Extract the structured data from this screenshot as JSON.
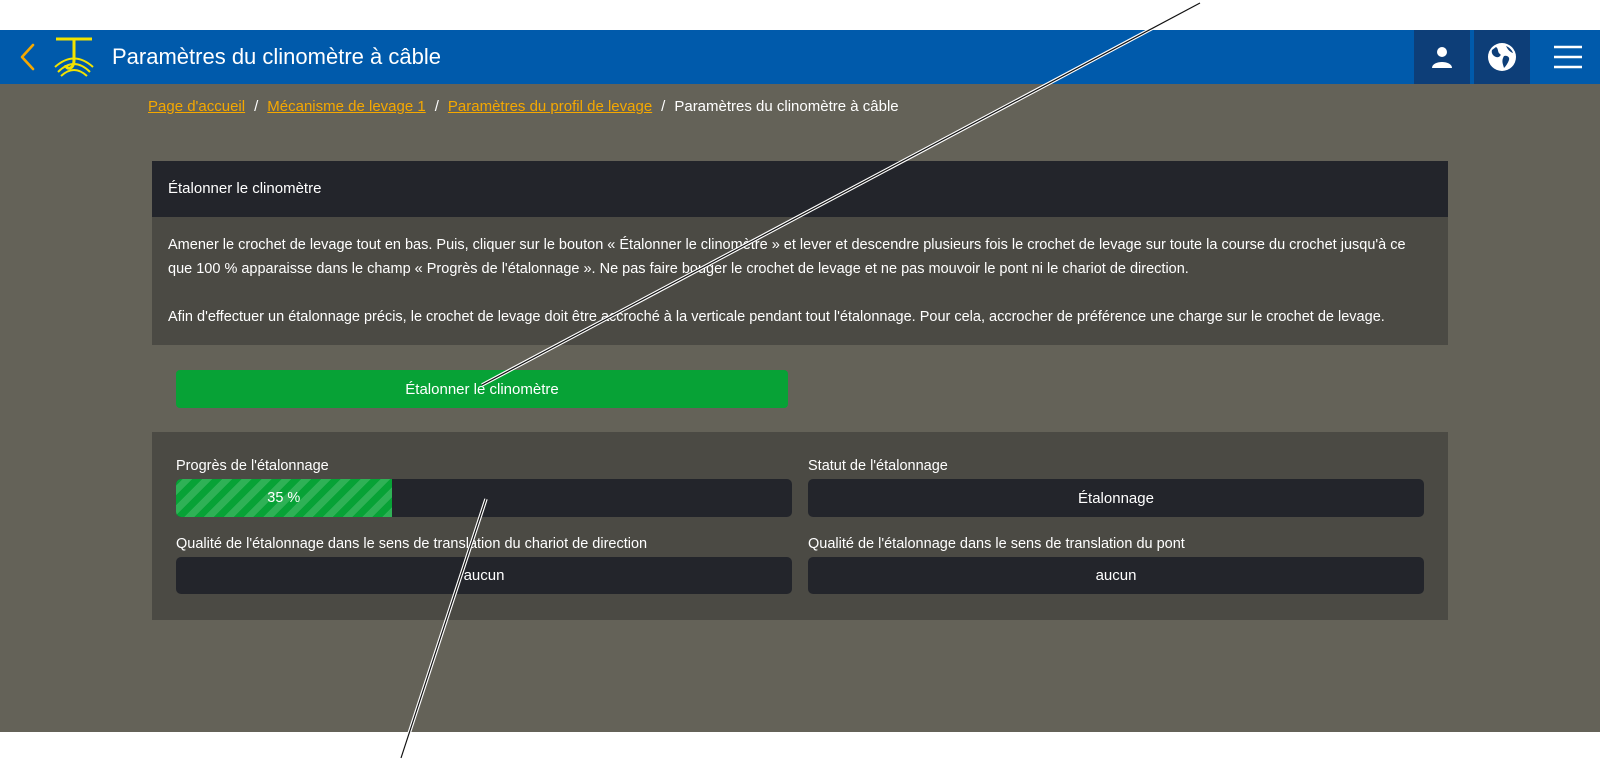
{
  "header": {
    "title": "Paramètres du clinomètre à câble",
    "back_icon": "chevron-left-icon",
    "logo_icon": "crane-hook-logo",
    "user_icon": "user-icon",
    "language_icon": "globe-icon",
    "menu_icon": "hamburger-menu-icon"
  },
  "breadcrumb": {
    "items": [
      {
        "label": "Page d'accueil"
      },
      {
        "label": "Mécanisme de levage 1"
      },
      {
        "label": "Paramètres du profil de levage"
      },
      {
        "label": "Paramètres du clinomètre à câble"
      }
    ],
    "separator": "/"
  },
  "calibrate_card": {
    "title": "Étalonner le clinomètre",
    "paragraph1": "Amener le crochet de levage tout en bas. Puis, cliquer sur le bouton « Étalonner le clinomètre » et lever et descendre plusieurs fois le crochet de levage sur toute la course du crochet jusqu'à ce que 100 % apparaisse dans le champ « Progrès de l'étalonnage ». Ne pas faire bouger le crochet de levage et ne pas mouvoir le pont ni le chariot de direction.",
    "paragraph2": "Afin d'effectuer un étalonnage précis, le crochet de levage doit être accroché à la verticale pendant tout l'étalonnage. Pour cela, accrocher de préférence une charge sur le crochet de levage.",
    "button_label": "Étalonner le clinomètre"
  },
  "status_card": {
    "progress_label": "Progrès de l'étalonnage",
    "progress_percent": 35,
    "progress_text": "35 %",
    "status_label": "Statut de l'étalonnage",
    "status_value": "Étalonnage",
    "quality_trolley_label": "Qualité de l'étalonnage dans le sens de translation du chariot de direction",
    "quality_trolley_value": "aucun",
    "quality_bridge_label": "Qualité de l'étalonnage dans le sens de translation du pont",
    "quality_bridge_value": "aucun"
  },
  "colors": {
    "header_bg": "#005aab",
    "accent": "#f5a800",
    "success": "#07a236",
    "page_bg": "#646258",
    "card_bg": "#4b4a44",
    "field_bg": "#23252b"
  }
}
